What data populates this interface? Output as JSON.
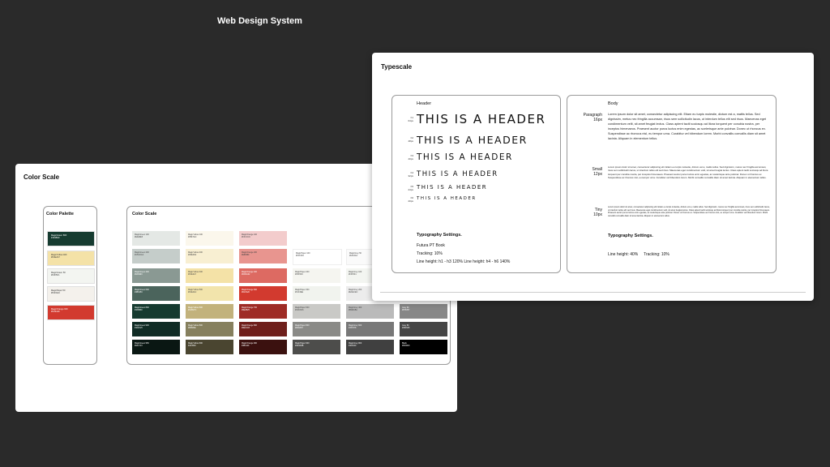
{
  "page_title": "Web Design System",
  "color_panel": {
    "title": "Color Scale",
    "palette_card": {
      "title": "Color Palette",
      "swatches": [
        {
          "color": "#163b30",
          "label": "MagicGreen 800\n#163B30",
          "text_color": "#ffffff"
        },
        {
          "color": "#f4e2a7",
          "label": "MagicYellow 400\n#F4E2A7",
          "text_color": "#333333"
        },
        {
          "color": "#f3f5f1",
          "label": "MagicGreen 50\n#F3F5F1",
          "text_color": "#333333"
        },
        {
          "color": "#f4f1ec",
          "label": "MagicPaper 50\n#F4F1EC",
          "text_color": "#333333"
        },
        {
          "color": "#d23a2f",
          "label": "MagicOrange 600\n#D23A2F",
          "text_color": "#ffffff"
        }
      ]
    },
    "scale_card": {
      "title": "Color Scale",
      "rows": [
        [
          {
            "color": "#e4e8e5",
            "label": "MagicGreen 100\n#E4E8E5",
            "text_color": "#444444"
          },
          {
            "color": "#fbf7ec",
            "label": "MagicYellow 100\n#FBF7EC",
            "text_color": "#444444"
          },
          {
            "color": "#f3cccc",
            "label": "MagicOrange 100\n#F3CCCC",
            "text_color": "#444444"
          },
          {
            "color": "",
            "label": "",
            "text_color": ""
          },
          {
            "color": "",
            "label": "",
            "text_color": ""
          },
          {
            "color": "",
            "label": "",
            "text_color": ""
          }
        ],
        [
          {
            "color": "#c5cdca",
            "label": "MagicGreen 200\n#C5CDCA",
            "text_color": "#444444"
          },
          {
            "color": "#f8efd2",
            "label": "MagicYellow 200\n#F8EFD2",
            "text_color": "#444444"
          },
          {
            "color": "#e8958f",
            "label": "MagicOrange 200\n#E8958F",
            "text_color": "#444444"
          },
          {
            "color": "#ffffff",
            "label": "MagicPaper 100\n#FFFFFF",
            "text_color": "#444444"
          },
          {
            "color": "#fafafa",
            "label": "MagicGrey 50\n#FAFAFA",
            "text_color": "#444444"
          },
          {
            "color": "#ffffff",
            "label": "White\n#FFFFFF",
            "text_color": "#444444"
          }
        ],
        [
          {
            "color": "#8a9993",
            "label": "MagicGreen 400\n#8A9993",
            "text_color": "#ffffff"
          },
          {
            "color": "#f4e2a7",
            "label": "MagicYellow 400\n#F4E2A7",
            "text_color": "#444444"
          },
          {
            "color": "#dd6a62",
            "label": "MagicOrange 400\n#DD6A62",
            "text_color": "#ffffff"
          },
          {
            "color": "#f5f5f0",
            "label": "MagicPaper 200\n#F5F5F0",
            "text_color": "#444444"
          },
          {
            "color": "#f3f5f1",
            "label": "MagicGrey 100\n#F3F5F1",
            "text_color": "#444444"
          },
          {
            "color": "",
            "label": "",
            "text_color": ""
          }
        ],
        [
          {
            "color": "#4b645c",
            "label": "MagicGreen 600\n#4B645C",
            "text_color": "#ffffff"
          },
          {
            "color": "#f2e4ac",
            "label": "MagicYellow 500\n#F2E4AC",
            "text_color": "#444444"
          },
          {
            "color": "#d23a2f",
            "label": "MagicOrange 600\n#D23A2F",
            "text_color": "#ffffff"
          },
          {
            "color": "#f1f3ee",
            "label": "MagicPaper 300\n#F1F3EE",
            "text_color": "#444444"
          },
          {
            "color": "#ececec",
            "label": "MagicGrey 200\n#ECECEC",
            "text_color": "#444444"
          },
          {
            "color": "",
            "label": "",
            "text_color": ""
          }
        ],
        [
          {
            "color": "#163b30",
            "label": "MagicGreen 800\n#163B30",
            "text_color": "#ffffff"
          },
          {
            "color": "#c2b27c",
            "label": "MagicYellow 600\n#C2B27C",
            "text_color": "#ffffff"
          },
          {
            "color": "#9e2b25",
            "label": "MagicOrange 700\n#9E2B25",
            "text_color": "#ffffff"
          },
          {
            "color": "#c9c9c6",
            "label": "MagicPaper 600\n#C9C9C6",
            "text_color": "#444444"
          },
          {
            "color": "#bababa",
            "label": "MagicGrey 400\n#BABABA",
            "text_color": "#444444"
          },
          {
            "color": "#878787",
            "label": "Grey 60\n#878787",
            "text_color": "#ffffff"
          }
        ],
        [
          {
            "color": "#102c25",
            "label": "MagicGreen 900\n#102C25",
            "text_color": "#ffffff"
          },
          {
            "color": "#86805e",
            "label": "MagicYellow 800\n#86805E",
            "text_color": "#ffffff"
          },
          {
            "color": "#6e1f1b",
            "label": "MagicOrange 800\n#6E1F1B",
            "text_color": "#ffffff"
          },
          {
            "color": "#8a8a87",
            "label": "MagicPaper 800\n#8A8A87",
            "text_color": "#ffffff"
          },
          {
            "color": "#787878",
            "label": "MagicGrey 600\n#787878",
            "text_color": "#ffffff"
          },
          {
            "color": "#454545",
            "label": "Grey 80\n#454545",
            "text_color": "#ffffff"
          }
        ],
        [
          {
            "color": "#0a1713",
            "label": "MagicGreen 950\n#0A1713",
            "text_color": "#ffffff"
          },
          {
            "color": "#4a4530",
            "label": "MagicYellow 900\n#4A4530",
            "text_color": "#ffffff"
          },
          {
            "color": "#3b110f",
            "label": "MagicOrange 900\n#3B110F",
            "text_color": "#ffffff"
          },
          {
            "color": "#4d4d4b",
            "label": "MagicPaper 900\n#4D4D4B",
            "text_color": "#ffffff"
          },
          {
            "color": "#404040",
            "label": "MagicGrey 800\n#404040",
            "text_color": "#ffffff"
          },
          {
            "color": "#000000",
            "label": "Black\n#000000",
            "text_color": "#ffffff"
          }
        ]
      ]
    }
  },
  "type_panel": {
    "title": "Typescale",
    "header_card": {
      "label": "Header",
      "sample_text": "THIS IS A HEADER",
      "levels": [
        {
          "tag": "h1\n64px",
          "font_size": 15
        },
        {
          "tag": "h2\n48px",
          "font_size": 12.5
        },
        {
          "tag": "h3\n40px",
          "font_size": 10.5
        },
        {
          "tag": "h4\n32px",
          "font_size": 8.5
        },
        {
          "tag": "h5\n24px",
          "font_size": 7
        },
        {
          "tag": "h6\n20px",
          "font_size": 5.5
        }
      ],
      "settings_title": "Typography Settings.",
      "settings_lines": [
        "Futura PT Book",
        "Tracking: 10%",
        "Line height: h1 - h3 120%   Line height: h4 - h6 140%"
      ]
    },
    "body_card": {
      "label": "Body",
      "paragraph": {
        "tag": "Paragraph\n16px",
        "text": "Lorem ipsum dolor sit amet, consectetur adipiscing elit. Etiam eu turpis molestie, dictum est a, mattis tellus. Sed dignissim, metus nec fringilla accumsan, risus sem sollicitudin lacus, ut interdum tellus elit sed risus. Maecenas eget condimentum velit, sit amet feugiat lectus. Class aptent taciti sociosqu ad litora torquent per conubia nostra, per inceptos himenaeos. Praesent auctor purus luctus enim egestas, ac scelerisque ante pulvinar. Donec ut rhoncus ex. Suspendisse ac rhoncus nisl, eu tempor urna. Curabitur vel bibendum lorem. Morbi convallis convallis diam sit amet lacinia. Aliquam in elementum tellus."
      },
      "small": {
        "tag": "Small\n12px",
        "text": "Lorem ipsum dolor sit amet, consectetur adipiscing elit. Etiam eu turpis molestie, dictum est a, mattis tellus. Sed dignissim, metus nec fringilla accumsan, risus sem sollicitudin lacus, ut interdum tellus elit sed risus. Maecenas eget condimentum velit, sit amet feugiat lectus. Class aptent taciti sociosqu ad litora torquent per conubia nostra, per inceptos himenaeos. Praesent auctor purus luctus enim egestas, ac scelerisque ante pulvinar. Donec ut rhoncus ex. Suspendisse ac rhoncus nisl, eu tempor urna. Curabitur vel bibendum lorem. Morbi convallis convallis diam sit amet lacinia. Aliquam in elementum tellus."
      },
      "tiny": {
        "tag": "Tiny\n10px",
        "text": "Lorem ipsum dolor sit amet, consectetur adipiscing elit. Etiam eu turpis molestie, dictum est a, mattis tellus. Sed dignissim, metus nec fringilla accumsan, risus sem sollicitudin lacus, ut interdum tellus elit sed risus. Maecenas eget condimentum velit, sit amet feugiat lectus. Class aptent taciti sociosqu ad litora torquent per conubia nostra, per inceptos himenaeos. Praesent auctor purus luctus enim egestas, ac scelerisque ante pulvinar. Donec ut rhoncus ex. Suspendisse ac rhoncus nisl, eu tempor urna. Curabitur vel bibendum lorem. Morbi convallis convallis diam sit amet lacinia. Aliquam in elementum tellus."
      },
      "settings_title": "Typography Settings.",
      "settings_line": "Line height: 40%     Tracking: 10%"
    }
  }
}
